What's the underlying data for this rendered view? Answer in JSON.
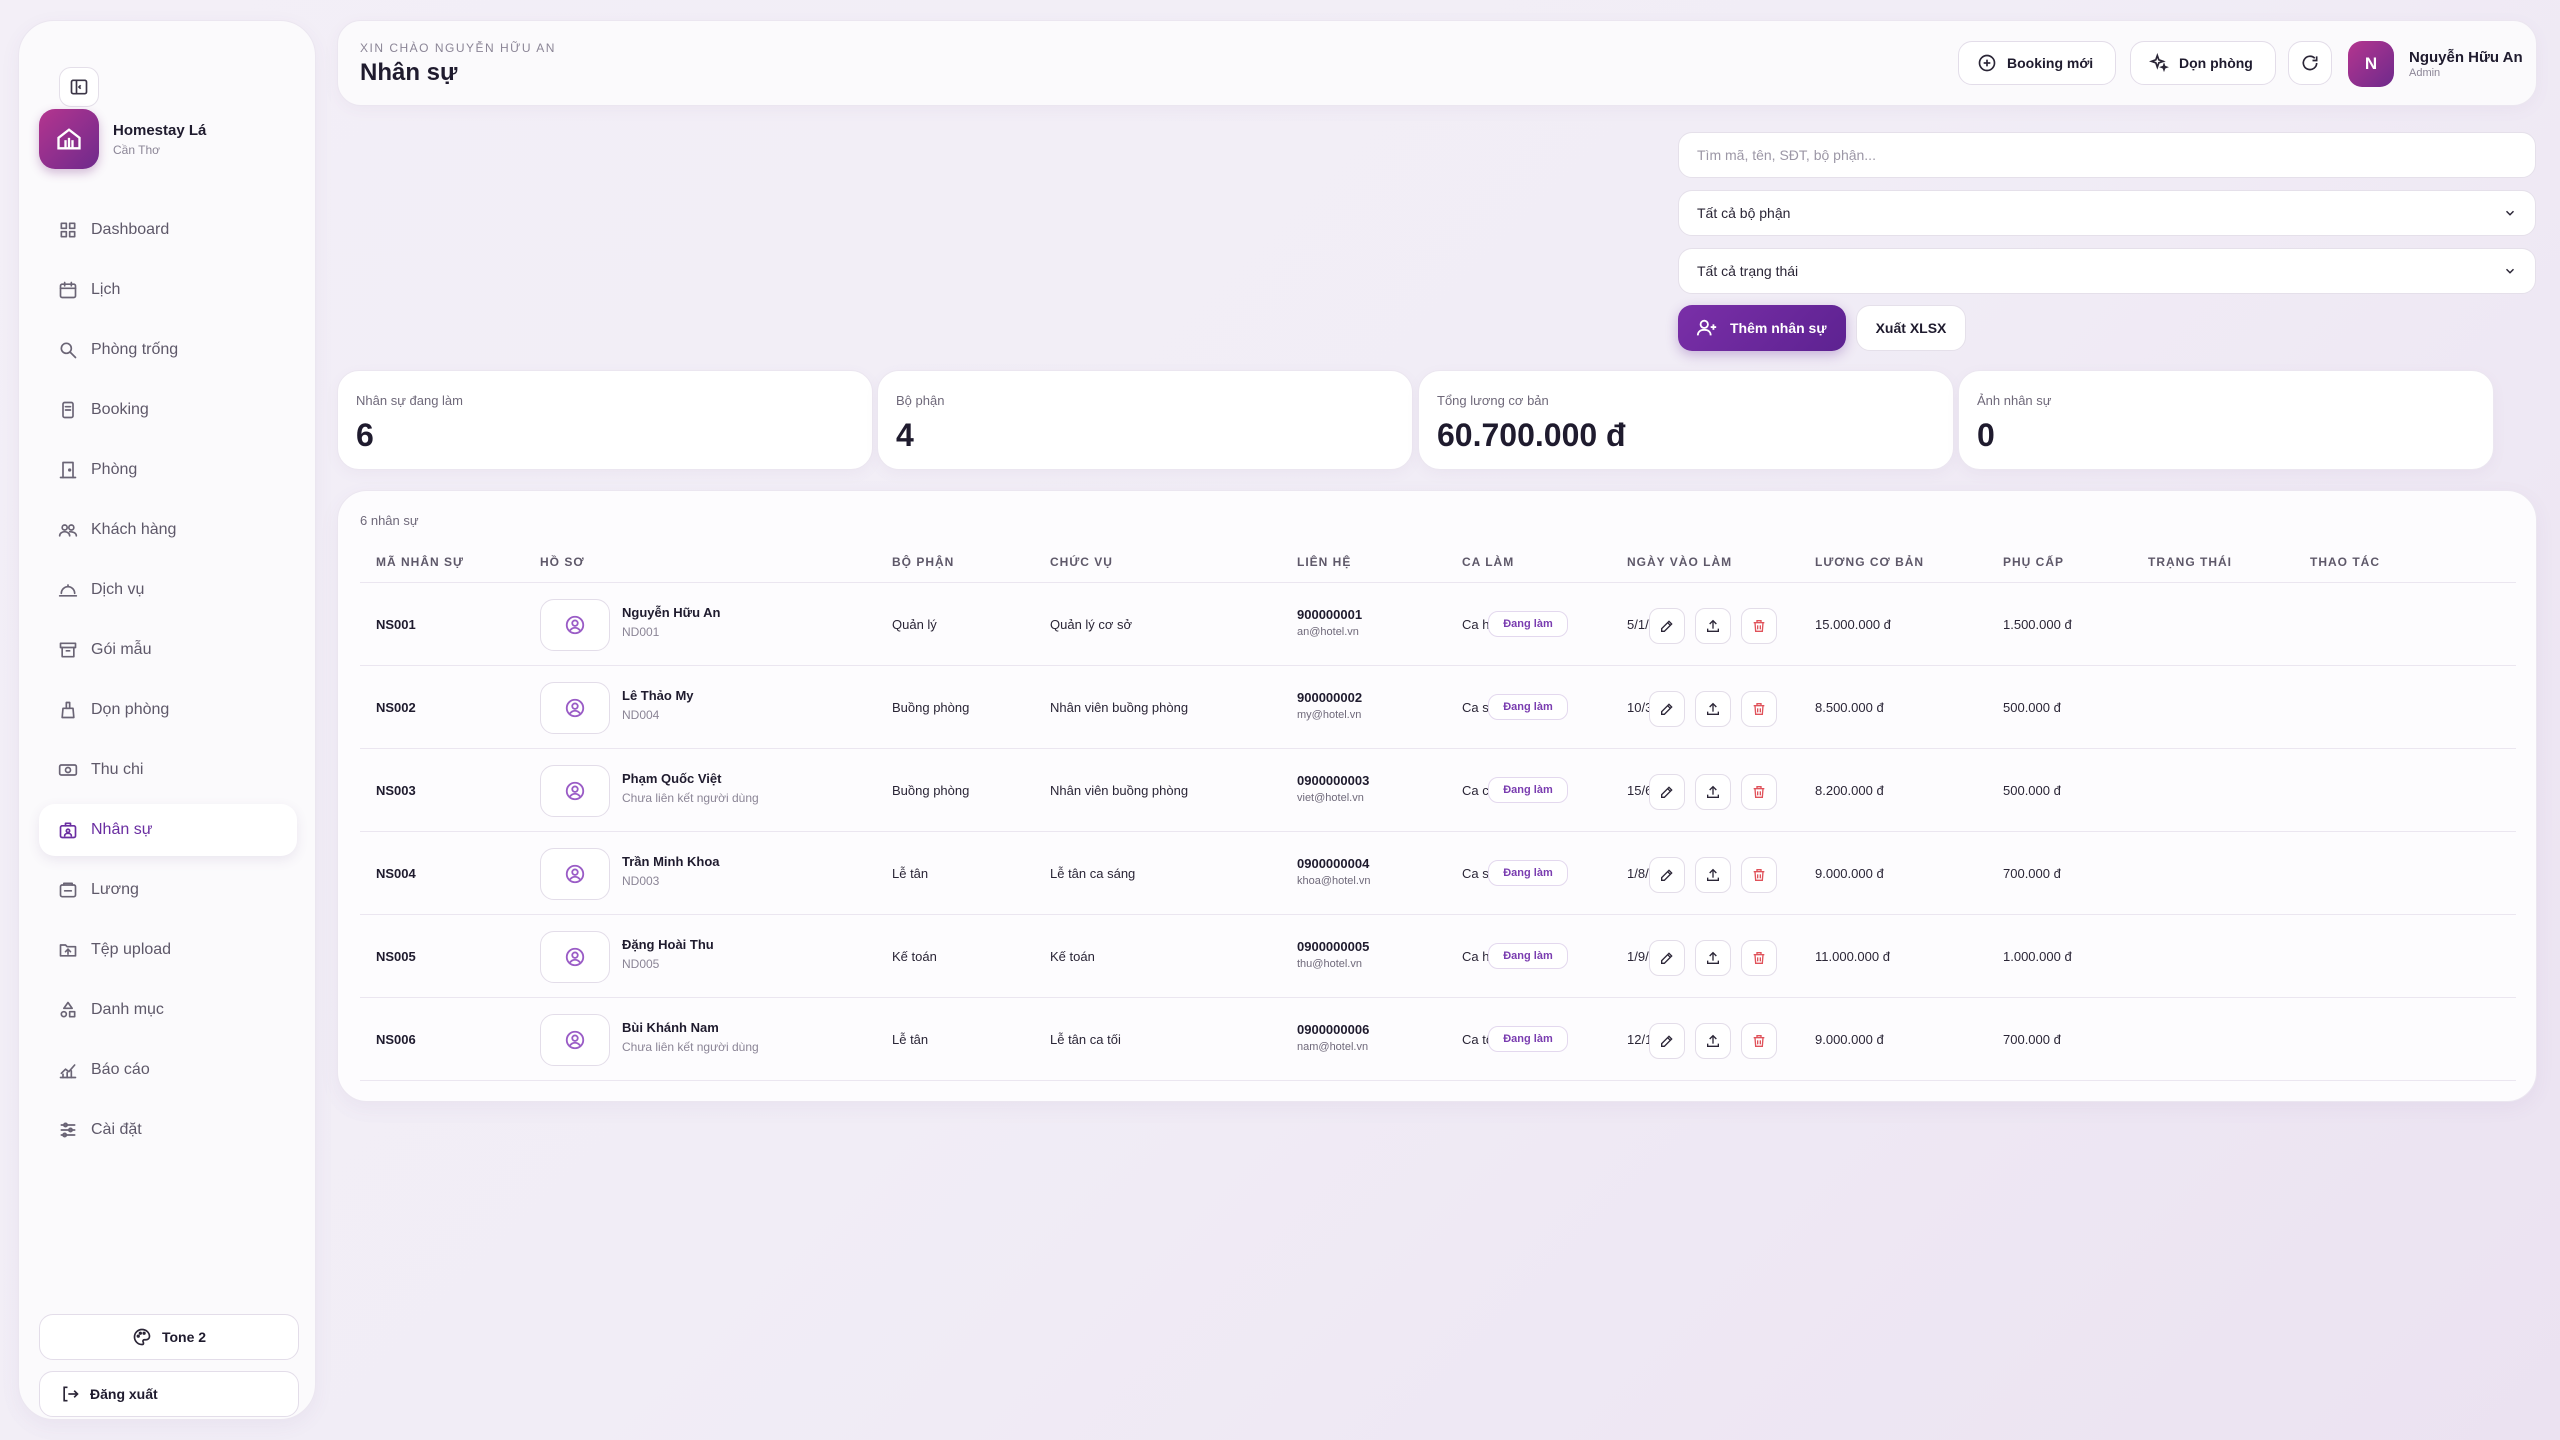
{
  "brand": {
    "name": "Homestay Lá",
    "location": "Cần Thơ"
  },
  "nav": [
    {
      "label": "Dashboard",
      "icon": "dashboard-icon"
    },
    {
      "label": "Lịch",
      "icon": "calendar-icon"
    },
    {
      "label": "Phòng trống",
      "icon": "search-icon"
    },
    {
      "label": "Booking",
      "icon": "booking-icon"
    },
    {
      "label": "Phòng",
      "icon": "door-icon"
    },
    {
      "label": "Khách hàng",
      "icon": "users-icon"
    },
    {
      "label": "Dịch vụ",
      "icon": "service-icon"
    },
    {
      "label": "Gói mẫu",
      "icon": "package-icon"
    },
    {
      "label": "Dọn phòng",
      "icon": "cleaning-icon"
    },
    {
      "label": "Thu chi",
      "icon": "money-icon"
    },
    {
      "label": "Nhân sự",
      "icon": "staff-icon",
      "active": true
    },
    {
      "label": "Lương",
      "icon": "salary-icon"
    },
    {
      "label": "Tệp upload",
      "icon": "folder-icon"
    },
    {
      "label": "Danh mục",
      "icon": "category-icon"
    },
    {
      "label": "Báo cáo",
      "icon": "report-icon"
    },
    {
      "label": "Cài đặt",
      "icon": "settings-icon"
    }
  ],
  "sidebar_footer": {
    "tone_label": "Tone 2",
    "logout_label": "Đăng xuất"
  },
  "header": {
    "greeting": "XIN CHÀO NGUYỄN HỮU AN",
    "title": "Nhân sự",
    "booking_btn": "Booking mới",
    "clean_btn": "Dọn phòng",
    "user_initial": "N",
    "user_name": "Nguyễn Hữu An",
    "user_role": "Admin"
  },
  "filters": {
    "search_placeholder": "Tìm mã, tên, SĐT, bộ phận...",
    "dept_selected": "Tất cả bộ phận",
    "status_selected": "Tất cả trạng thái",
    "add_btn": "Thêm nhân sự",
    "export_btn": "Xuất XLSX"
  },
  "stats": [
    {
      "label": "Nhân sự đang làm",
      "value": "6"
    },
    {
      "label": "Bộ phận",
      "value": "4"
    },
    {
      "label": "Tổng lương cơ bản",
      "value": "60.700.000 đ"
    },
    {
      "label": "Ảnh nhân sự",
      "value": "0"
    }
  ],
  "table": {
    "count_label": "6 nhân sự",
    "headers": [
      "MÃ NHÂN SỰ",
      "HỒ SƠ",
      "BỘ PHẬN",
      "CHỨC VỤ",
      "LIÊN HỆ",
      "CA LÀM",
      "NGÀY VÀO LÀM",
      "LƯƠNG CƠ BẢN",
      "PHỤ CẤP",
      "TRẠNG THÁI",
      "THAO TÁC"
    ],
    "rows": [
      {
        "id": "NS001",
        "name": "Nguyễn Hữu An",
        "sub": "ND001",
        "dept": "Quản lý",
        "role": "Quản lý cơ sở",
        "phone": "900000001",
        "email": "an@hotel.vn",
        "shift": "Ca hành chính",
        "start": "5/1/2024",
        "salary": "15.000.000 đ",
        "allowance": "1.500.000 đ",
        "status": "Đang làm"
      },
      {
        "id": "NS002",
        "name": "Lê Thảo My",
        "sub": "ND004",
        "dept": "Buồng phòng",
        "role": "Nhân viên buồng phòng",
        "phone": "900000002",
        "email": "my@hotel.vn",
        "shift": "Ca sáng",
        "start": "10/3/2024",
        "salary": "8.500.000 đ",
        "allowance": "500.000 đ",
        "status": "Đang làm"
      },
      {
        "id": "NS003",
        "name": "Phạm Quốc Việt",
        "sub": "Chưa liên kết người dùng",
        "dept": "Buồng phòng",
        "role": "Nhân viên buồng phòng",
        "phone": "0900000003",
        "email": "viet@hotel.vn",
        "shift": "Ca chiều",
        "start": "15/6/2024",
        "salary": "8.200.000 đ",
        "allowance": "500.000 đ",
        "status": "Đang làm"
      },
      {
        "id": "NS004",
        "name": "Trần Minh Khoa",
        "sub": "ND003",
        "dept": "Lễ tân",
        "role": "Lễ tân ca sáng",
        "phone": "0900000004",
        "email": "khoa@hotel.vn",
        "shift": "Ca sáng",
        "start": "1/8/2024",
        "salary": "9.000.000 đ",
        "allowance": "700.000 đ",
        "status": "Đang làm"
      },
      {
        "id": "NS005",
        "name": "Đặng Hoài Thu",
        "sub": "ND005",
        "dept": "Kế toán",
        "role": "Kế toán",
        "phone": "0900000005",
        "email": "thu@hotel.vn",
        "shift": "Ca hành chính",
        "start": "1/9/2024",
        "salary": "11.000.000 đ",
        "allowance": "1.000.000 đ",
        "status": "Đang làm"
      },
      {
        "id": "NS006",
        "name": "Bùi Khánh Nam",
        "sub": "Chưa liên kết người dùng",
        "dept": "Lễ tân",
        "role": "Lễ tân ca tối",
        "phone": "0900000006",
        "email": "nam@hotel.vn",
        "shift": "Ca tối",
        "start": "12/1/2025",
        "salary": "9.000.000 đ",
        "allowance": "700.000 đ",
        "status": "Đang làm"
      }
    ]
  },
  "colors": {
    "accent": "#6a2ea1",
    "brand_from": "#b4358f",
    "brand_to": "#6e2a8c",
    "danger": "#e0525a"
  }
}
